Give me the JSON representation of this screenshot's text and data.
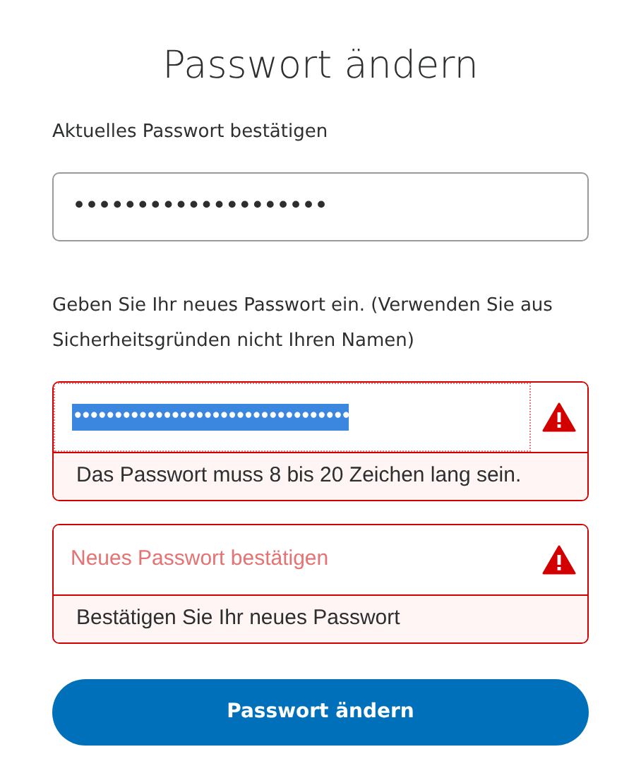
{
  "title": "Passwort ändern",
  "current": {
    "label": "Aktuelles Passwort bestätigen",
    "value": "••••••••••••••••••••"
  },
  "hint": "Geben Sie Ihr neues Passwort ein. (Verwenden Sie aus Sicherheitsgründen nicht Ihren Namen)",
  "fields": [
    {
      "value": "••••••••••••••••••••••••••••••••••",
      "selected": true,
      "error": "Das Passwort muss 8 bis 20 Zeichen lang sein."
    },
    {
      "placeholder": "Neues Passwort bestätigen",
      "error": "Bestätigen Sie Ihr neues Passwort"
    }
  ],
  "button": "Passwort ändern"
}
